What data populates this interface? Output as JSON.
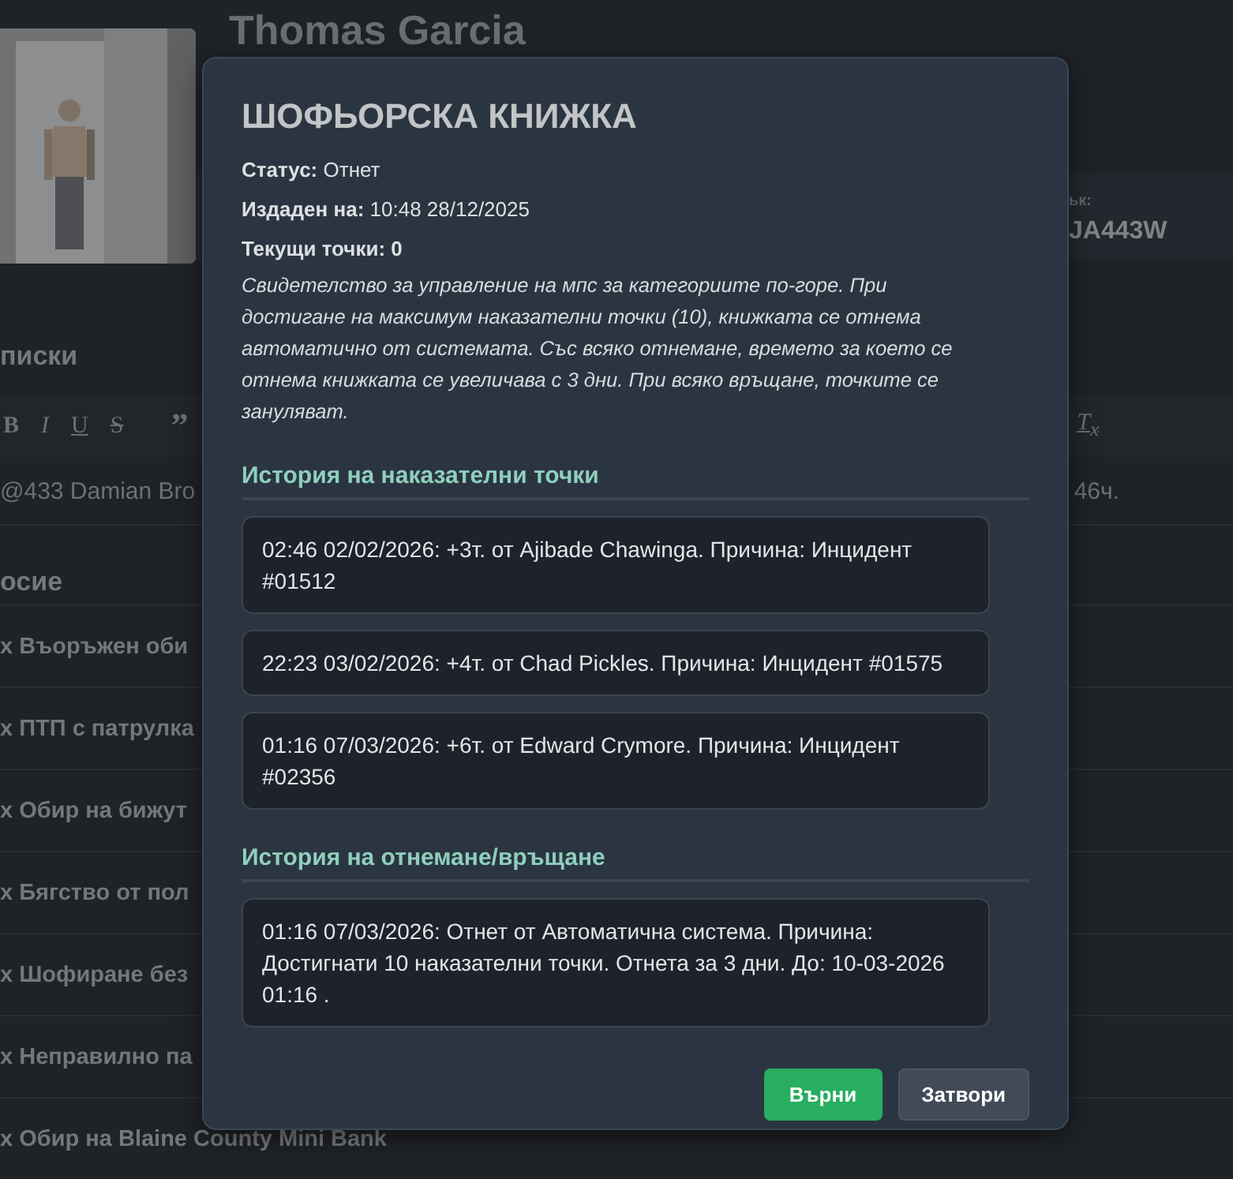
{
  "profile": {
    "name": "Thomas Garcia",
    "plate_label": "ьк:",
    "plate": "JA443W"
  },
  "notes": {
    "title": "писки",
    "toolbar": [
      "B",
      "I",
      "U",
      "S",
      "”"
    ],
    "clear_format": "T$_{x}$",
    "text_start": "@433 Damian Bro",
    "text_end": "46ч."
  },
  "record": {
    "title": "осие",
    "items": [
      "х Въоръжен оби",
      "х ПТП с патрулка",
      "х Обир на бижут",
      "х Бягство от пол",
      "х Шофиране без",
      "х Неправилно па",
      "х Обир на Blaine County Mini Bank"
    ]
  },
  "modal": {
    "title": "ШОФЬОРСКА КНИЖКА",
    "fields": [
      {
        "label": "Статус:",
        "value": "Отнет",
        "emphasis": false
      },
      {
        "label": "Издаден на:",
        "value": "10:48 28/12/2025",
        "emphasis": false
      },
      {
        "label": "Текущи точки:",
        "value": "0",
        "emphasis": true
      }
    ],
    "description": "Свидетелство за управление на мпс за категориите по-горе. При достигане на максимум наказателни точки (10), книжката се отнема автоматично от системата. Със всяко отнемане, времето за което се отнема книжката се увеличава с 3 дни. При всяко връщане, точките се зануляват.",
    "points_title": "История на наказателни точки",
    "points": [
      "02:46 02/02/2026: +3т. от Ajibade Chawinga. Причина: Инцидент #01512",
      "22:23 03/02/2026: +4т. от Chad Pickles. Причина: Инцидент #01575",
      "01:16 07/03/2026: +6т. от Edward Crymore. Причина: Инцидент #02356"
    ],
    "revocations_title": "История на отнемане/връщане",
    "revocations": [
      "01:16 07/03/2026: Отнет от Автоматична система. Причина: Достигнати 10 наказателни точки. Отнета за 3 дни. До: 10-03-2026 01:16 ."
    ],
    "buttons": [
      {
        "label": "Върни",
        "kind": "primary"
      },
      {
        "label": "Затвори",
        "kind": "secondary"
      }
    ]
  }
}
